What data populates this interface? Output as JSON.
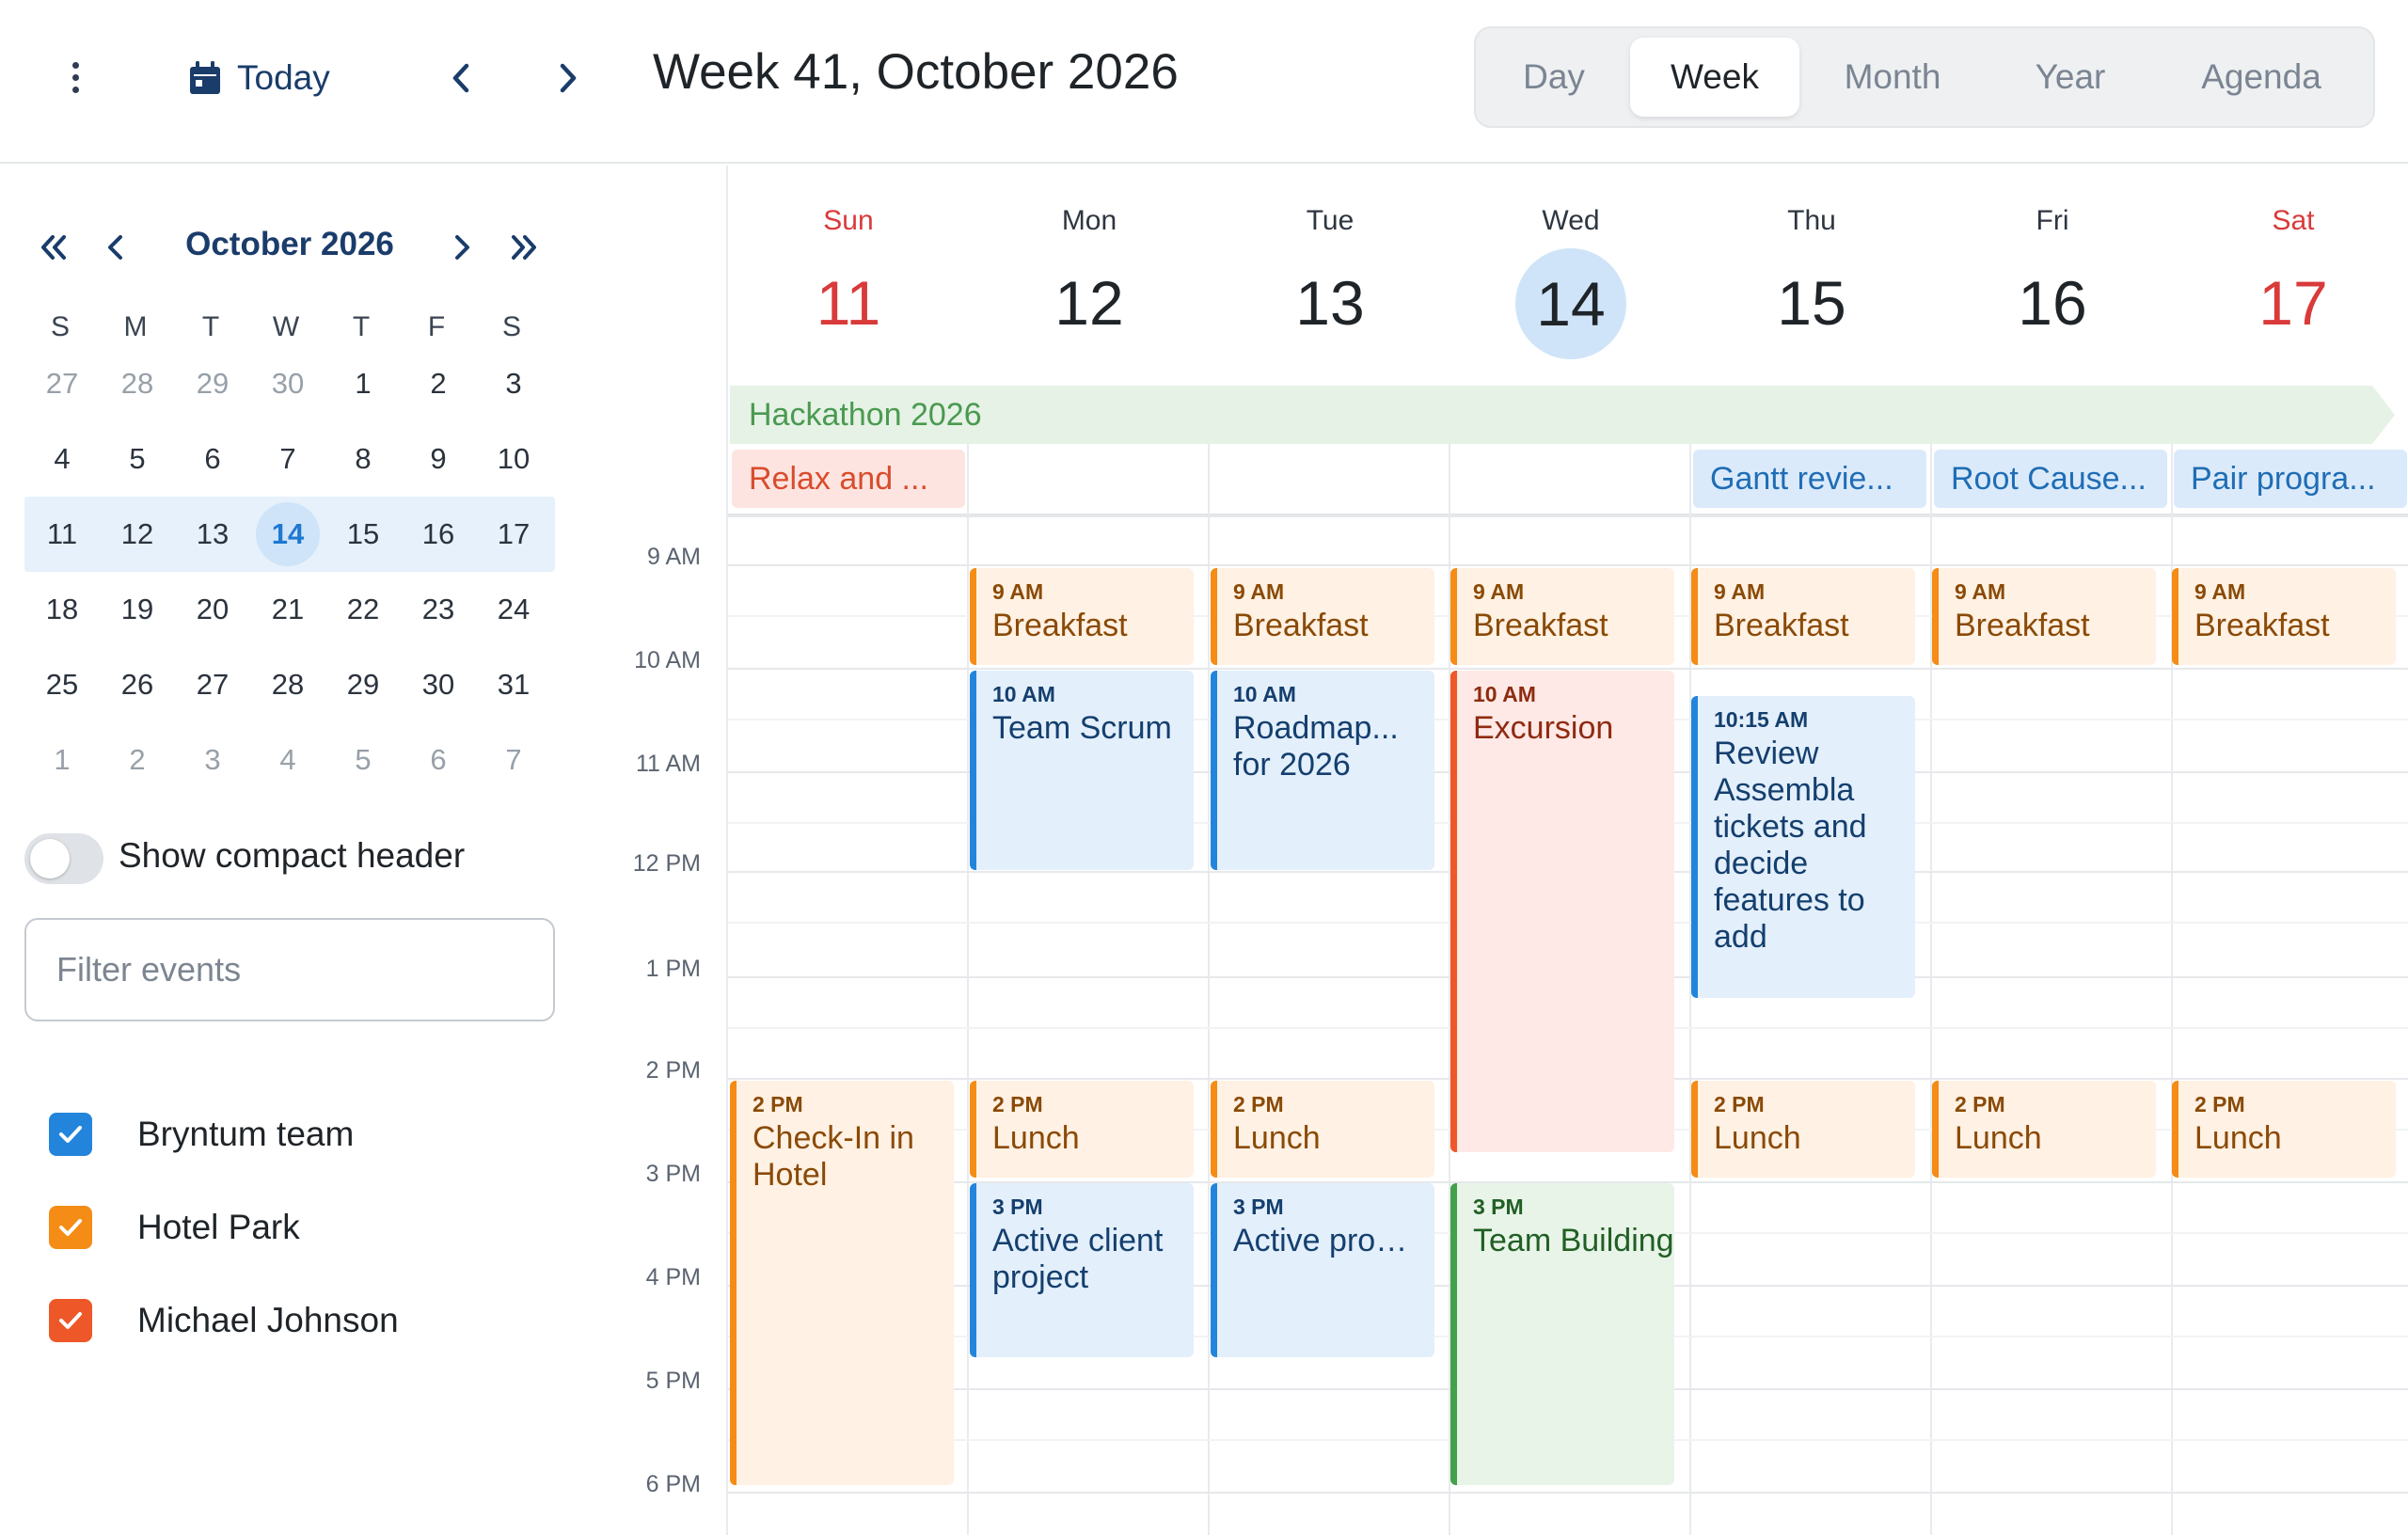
{
  "toolbar": {
    "menu_icon": "vertical-dots-icon",
    "today_label": "Today",
    "title": "Week 41, October 2026",
    "modes": [
      "Day",
      "Week",
      "Month",
      "Year",
      "Agenda"
    ],
    "active_mode": "Week"
  },
  "mini_calendar": {
    "title": "October 2026",
    "weekdays": [
      "S",
      "M",
      "T",
      "W",
      "T",
      "F",
      "S"
    ],
    "weeks": [
      [
        "27",
        "28",
        "29",
        "30",
        "1",
        "2",
        "3"
      ],
      [
        "4",
        "5",
        "6",
        "7",
        "8",
        "9",
        "10"
      ],
      [
        "11",
        "12",
        "13",
        "14",
        "15",
        "16",
        "17"
      ],
      [
        "18",
        "19",
        "20",
        "21",
        "22",
        "23",
        "24"
      ],
      [
        "25",
        "26",
        "27",
        "28",
        "29",
        "30",
        "31"
      ],
      [
        "1",
        "2",
        "3",
        "4",
        "5",
        "6",
        "7"
      ]
    ],
    "selected_week_index": 2,
    "today": "14"
  },
  "compact_header": {
    "label": "Show compact header",
    "on": false
  },
  "filter": {
    "placeholder": "Filter events",
    "value": ""
  },
  "resources": [
    {
      "name": "Bryntum team",
      "color": "#2384db",
      "checked": true
    },
    {
      "name": "Hotel Park",
      "color": "#f48c15",
      "checked": true
    },
    {
      "name": "Michael Johnson",
      "color": "#ee5727",
      "checked": true
    }
  ],
  "week": {
    "days": [
      {
        "name": "Sun",
        "num": "11"
      },
      {
        "name": "Mon",
        "num": "12"
      },
      {
        "name": "Tue",
        "num": "13"
      },
      {
        "name": "Wed",
        "num": "14"
      },
      {
        "name": "Thu",
        "num": "15"
      },
      {
        "name": "Fri",
        "num": "16"
      },
      {
        "name": "Sat",
        "num": "17"
      }
    ],
    "time_labels": [
      "9 AM",
      "10 AM",
      "11 AM",
      "12 PM",
      "1 PM",
      "2 PM",
      "3 PM",
      "4 PM",
      "5 PM",
      "6 PM"
    ],
    "all_day": {
      "multi_day": "Hackathon 2026",
      "single": [
        "Relax and ...",
        "",
        "",
        "",
        "Gantt revie...",
        "Root Cause...",
        "Pair progra..."
      ]
    },
    "events": [
      {
        "time": "9 AM",
        "name": "Breakfast"
      },
      {
        "time": "9 AM",
        "name": "Breakfast"
      },
      {
        "time": "9 AM",
        "name": "Breakfast"
      },
      {
        "time": "9 AM",
        "name": "Breakfast"
      },
      {
        "time": "9 AM",
        "name": "Breakfast"
      },
      {
        "time": "9 AM",
        "name": "Breakfast"
      },
      {
        "time": "10 AM",
        "name": "Team Scrum"
      },
      {
        "time": "10 AM",
        "name": "Roadmap...",
        "name2": "for 2026"
      },
      {
        "time": "10 AM",
        "name": "Excursion"
      },
      {
        "time": "10:15 AM",
        "name": "Review Assembla tickets and decide features to add"
      },
      {
        "time": "2 PM",
        "name": "Check-In in Hotel"
      },
      {
        "time": "2 PM",
        "name": "Lunch"
      },
      {
        "time": "2 PM",
        "name": "Lunch"
      },
      {
        "time": "2 PM",
        "name": "Lunch"
      },
      {
        "time": "2 PM",
        "name": "Lunch"
      },
      {
        "time": "2 PM",
        "name": "Lunch"
      },
      {
        "time": "3 PM",
        "name": "Active client project"
      },
      {
        "time": "3 PM",
        "name": "Active programm..."
      },
      {
        "time": "3 PM",
        "name": "Team Building"
      }
    ]
  }
}
